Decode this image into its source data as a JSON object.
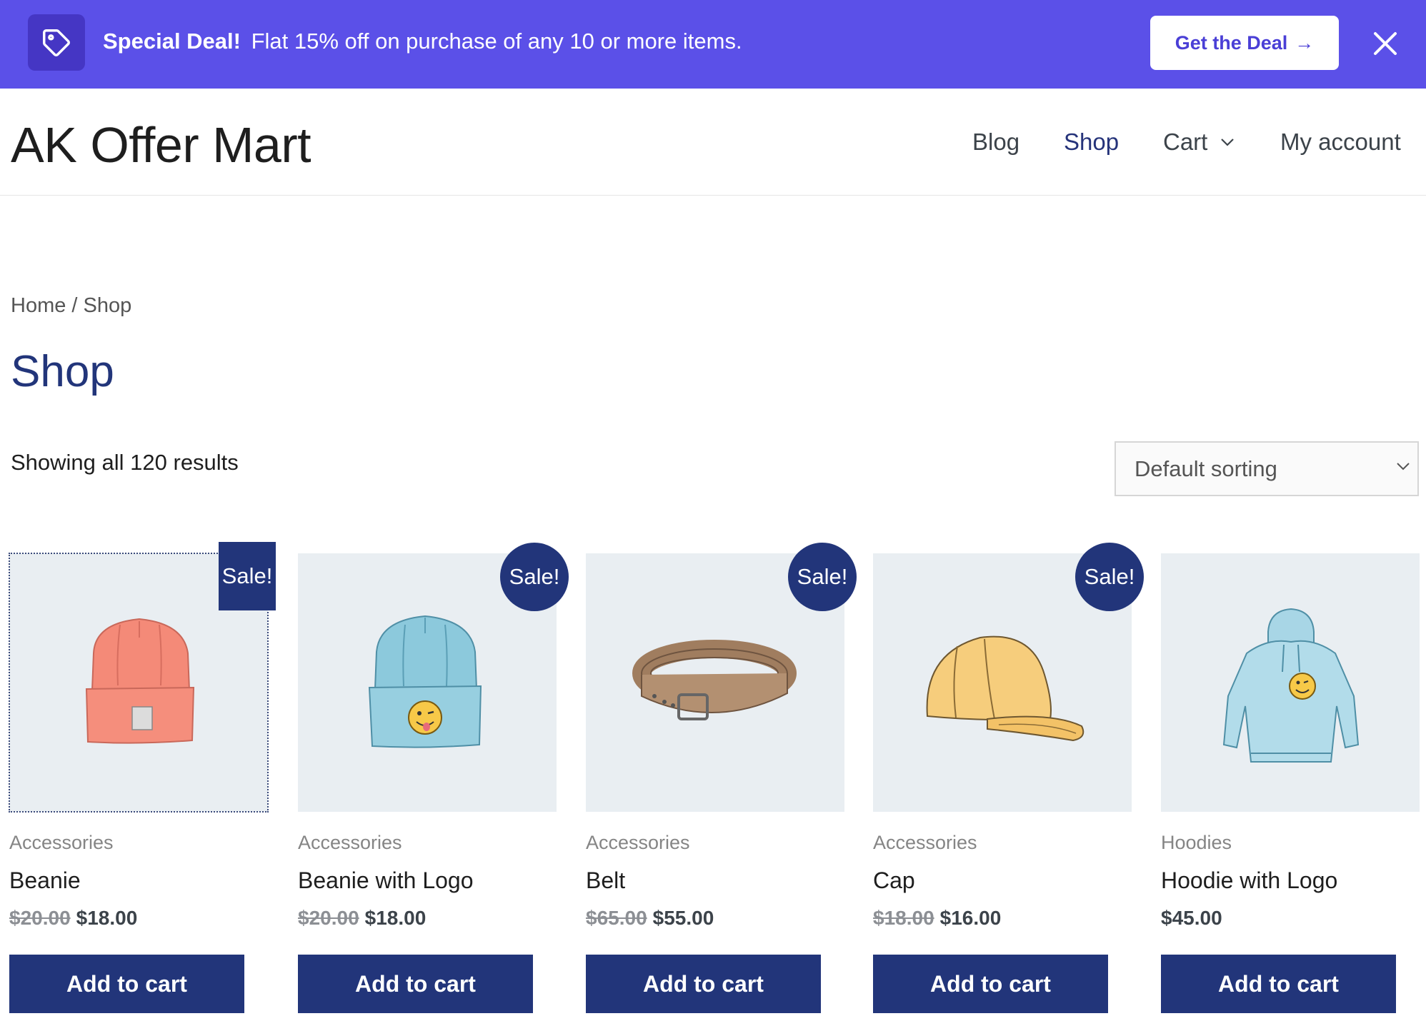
{
  "banner": {
    "title": "Special Deal!",
    "message": "Flat 15% off on purchase of any 10 or more items.",
    "button_label": "Get the Deal",
    "button_arrow": "→",
    "tag_icon": "tag-icon",
    "close_icon": "close-icon"
  },
  "header": {
    "site_title": "AK Offer Mart",
    "nav": {
      "blog": "Blog",
      "shop": "Shop",
      "cart": "Cart",
      "account": "My account"
    }
  },
  "breadcrumb": {
    "home": "Home",
    "separator": " / ",
    "current": "Shop"
  },
  "page_title": "Shop",
  "result_count": "Showing all 120 results",
  "sorting": {
    "selected": "Default sorting"
  },
  "products": [
    {
      "category": "Accessories",
      "name": "Beanie",
      "regular_price": "$20.00",
      "price": "$18.00",
      "sale_label": "Sale!",
      "button": "Add to cart",
      "image": "beanie-orange"
    },
    {
      "category": "Accessories",
      "name": "Beanie with Logo",
      "regular_price": "$20.00",
      "price": "$18.00",
      "sale_label": "Sale!",
      "button": "Add to cart",
      "image": "beanie-blue-logo"
    },
    {
      "category": "Accessories",
      "name": "Belt",
      "regular_price": "$65.00",
      "price": "$55.00",
      "sale_label": "Sale!",
      "button": "Add to cart",
      "image": "belt"
    },
    {
      "category": "Accessories",
      "name": "Cap",
      "regular_price": "$18.00",
      "price": "$16.00",
      "sale_label": "Sale!",
      "button": "Add to cart",
      "image": "cap"
    },
    {
      "category": "Hoodies",
      "name": "Hoodie with Logo",
      "price": "$45.00",
      "button": "Add to cart",
      "image": "hoodie-logo"
    }
  ],
  "colors": {
    "banner_bg": "#5b50e8",
    "brand_navy": "#22357a",
    "product_bg": "#e9eef2"
  }
}
